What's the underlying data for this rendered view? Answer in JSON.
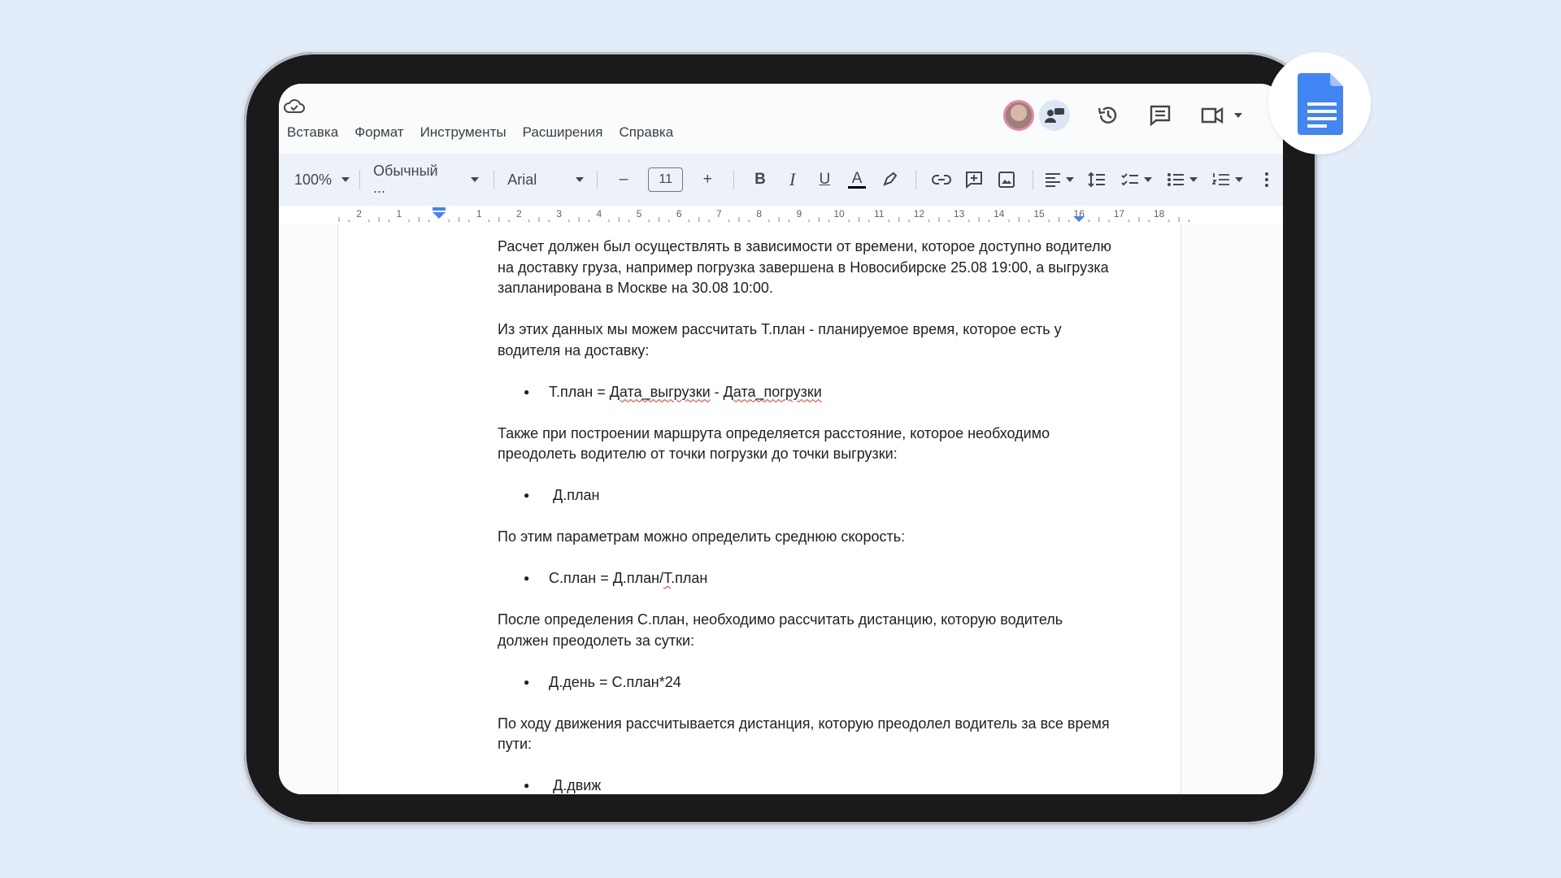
{
  "menu": [
    "Вставка",
    "Формат",
    "Инструменты",
    "Расширения",
    "Справка"
  ],
  "toolbar": {
    "zoom": "100%",
    "style": "Обычный ...",
    "font": "Arial",
    "font_size": "11",
    "minus": "–",
    "plus": "+",
    "bold": "B",
    "italic": "I",
    "underline": "U",
    "text_color": "A"
  },
  "ruler": {
    "left_labels": [
      "2",
      "1"
    ],
    "right_labels": [
      "1",
      "2",
      "3",
      "4",
      "5",
      "6",
      "7",
      "8",
      "9",
      "10",
      "11",
      "12",
      "13",
      "14",
      "15",
      "16",
      "17",
      "18"
    ]
  },
  "doc": {
    "p1": "Расчет должен был осуществлять в зависимости от времени, которое доступно водителю на доставку груза, например погрузка завершена в Новосибирске 25.08 19:00, а выгрузка запланирована в Москве на 30.08 10:00.",
    "p2": "Из этих данных мы можем рассчитать Т.план - планируемое время, которое есть у водителя на доставку:",
    "b1_a": "Т.план = ",
    "b1_b": "Дата_выгрузки",
    "b1_c": " - ",
    "b1_d": "Дата_погрузки",
    "p3": "Также при построении маршрута определяется расстояние, которое необходимо преодолеть водителю от точки погрузки до точки выгрузки:",
    "b2": "Д.план",
    "p4": "По этим параметрам можно определить среднюю скорость:",
    "b3_a": "С.план = Д.план/",
    "b3_b": "Т",
    "b3_c": ".план",
    "p5": "После определения С.план, необходимо рассчитать дистанцию, которую водитель должен преодолеть за сутки:",
    "b4": "Д.день = С.план*24",
    "p6": "По ходу движения рассчитывается дистанция, которую преодолел водитель за все время пути:",
    "b5": "Д.движ"
  },
  "colors": {
    "background": "#e3edfa",
    "toolbar": "#edf2fa",
    "docs_blue": "#4285f4",
    "ruler_marker": "#4285f4",
    "spell_underline": "#d93025"
  },
  "icons": [
    "cloud-icon",
    "history-icon",
    "comment-icon",
    "video-call-icon",
    "google-docs-icon"
  ]
}
